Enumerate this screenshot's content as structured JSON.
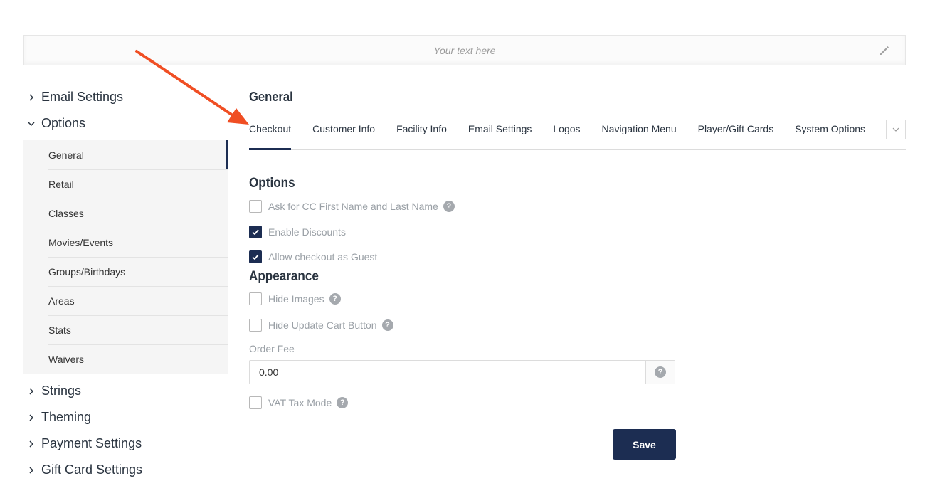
{
  "banner": {
    "text": "Your text here"
  },
  "sidebar": {
    "sections_top": [
      {
        "label": "Email Settings",
        "expanded": false
      },
      {
        "label": "Options",
        "expanded": true
      }
    ],
    "options_items": [
      {
        "label": "General",
        "active": true
      },
      {
        "label": "Retail"
      },
      {
        "label": "Classes"
      },
      {
        "label": "Movies/Events"
      },
      {
        "label": "Groups/Birthdays"
      },
      {
        "label": "Areas"
      },
      {
        "label": "Stats"
      },
      {
        "label": "Waivers"
      }
    ],
    "sections_bottom": [
      {
        "label": "Strings"
      },
      {
        "label": "Theming"
      },
      {
        "label": "Payment Settings"
      },
      {
        "label": "Gift Card Settings"
      }
    ]
  },
  "main": {
    "title": "General",
    "tabs": [
      {
        "label": "Checkout",
        "active": true
      },
      {
        "label": "Customer Info"
      },
      {
        "label": "Facility Info"
      },
      {
        "label": "Email Settings"
      },
      {
        "label": "Logos"
      },
      {
        "label": "Navigation Menu"
      },
      {
        "label": "Player/Gift Cards"
      },
      {
        "label": "System Options"
      }
    ],
    "options": {
      "heading": "Options",
      "items": [
        {
          "label": "Ask for CC First Name and Last Name",
          "checked": false,
          "help": true
        },
        {
          "label": "Enable Discounts",
          "checked": true,
          "help": false
        },
        {
          "label": "Allow checkout as Guest",
          "checked": true,
          "help": false
        }
      ]
    },
    "appearance": {
      "heading": "Appearance",
      "items": [
        {
          "label": "Hide Images",
          "checked": false,
          "help": true
        },
        {
          "label": "Hide Update Cart Button",
          "checked": false,
          "help": true
        }
      ]
    },
    "order_fee": {
      "label": "Order Fee",
      "value": "0.00"
    },
    "vat": {
      "label": "VAT Tax Mode",
      "checked": false,
      "help": true
    },
    "save_label": "Save"
  },
  "colors": {
    "accent": "#1c2d52",
    "arrow": "#f04e23"
  }
}
